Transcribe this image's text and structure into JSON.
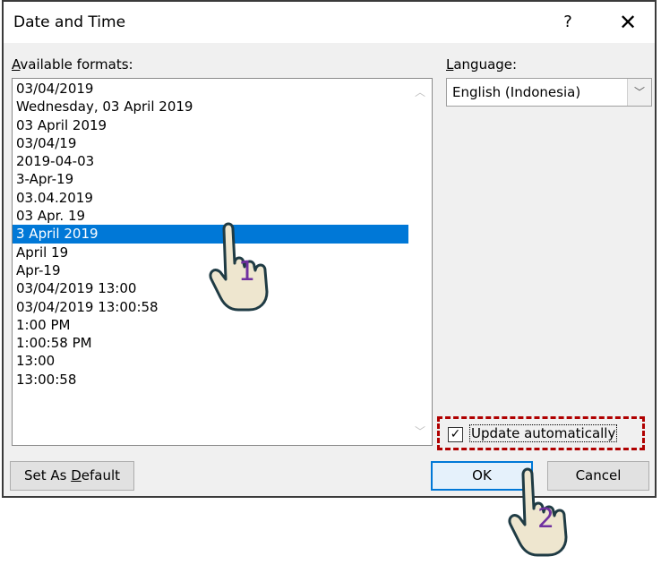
{
  "window": {
    "title": "Date and Time",
    "help_label": "?",
    "close_label": "✕"
  },
  "formats": {
    "label_accel": "A",
    "label_rest": "vailable formats:",
    "items": [
      "03/04/2019",
      "Wednesday, 03 April 2019",
      "03 April 2019",
      "03/04/19",
      "2019-04-03",
      "3-Apr-19",
      "03.04.2019",
      "03 Apr. 19",
      "3 April 2019",
      "April 19",
      "Apr-19",
      "03/04/2019 13:00",
      "03/04/2019 13:00:58",
      "1:00 PM",
      "1:00:58 PM",
      "13:00",
      "13:00:58"
    ],
    "selected_index": 8
  },
  "language": {
    "label_accel": "L",
    "label_rest": "anguage:",
    "selected": "English (Indonesia)"
  },
  "update_automatically": {
    "label": "Update automatically",
    "checked": true
  },
  "buttons": {
    "set_default_pre": "Set As ",
    "set_default_accel": "D",
    "set_default_post": "efault",
    "ok": "OK",
    "cancel": "Cancel"
  },
  "annotations": {
    "step1": "1",
    "step2": "2",
    "accent_color": "#7030a0",
    "highlight_color": "#b00000"
  }
}
